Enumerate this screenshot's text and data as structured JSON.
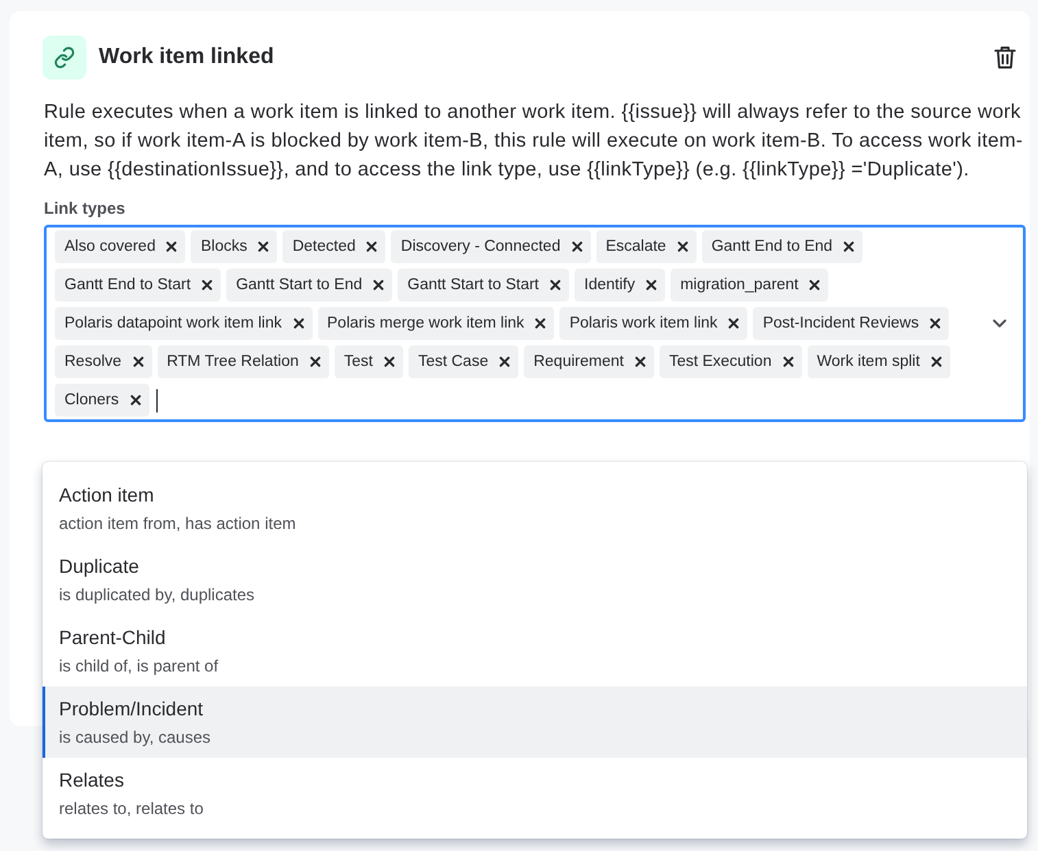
{
  "rule": {
    "title": "Work item linked",
    "description": "Rule executes when a work item is linked to another work item. {{issue}} will always refer to the source work item, so if work item-A is blocked by work item-B, this rule will execute on work item-B. To access work item-A, use {{destinationIssue}}, and to access the link type, use {{linkType}} (e.g. {{linkType}} ='Duplicate')."
  },
  "link_types": {
    "label": "Link types",
    "chips": [
      "Also covered",
      "Blocks",
      "Detected",
      "Discovery - Connected",
      "Escalate",
      "Gantt End to End",
      "Gantt End to Start",
      "Gantt Start to End",
      "Gantt Start to Start",
      "Identify",
      "migration_parent",
      "Polaris datapoint work item link",
      "Polaris merge work item link",
      "Polaris work item link",
      "Post-Incident Reviews",
      "Resolve",
      "RTM Tree Relation",
      "Test",
      "Test Case",
      "Requirement",
      "Test Execution",
      "Work item split",
      "Cloners"
    ]
  },
  "dropdown": {
    "options": [
      {
        "name": "Action item",
        "description": "action item from, has action item",
        "selected": false
      },
      {
        "name": "Duplicate",
        "description": "is duplicated by, duplicates",
        "selected": false
      },
      {
        "name": "Parent-Child",
        "description": "is child of, is parent of",
        "selected": false
      },
      {
        "name": "Problem/Incident",
        "description": "is caused by, causes",
        "selected": true
      },
      {
        "name": "Relates",
        "description": "relates to, relates to",
        "selected": false
      }
    ]
  }
}
